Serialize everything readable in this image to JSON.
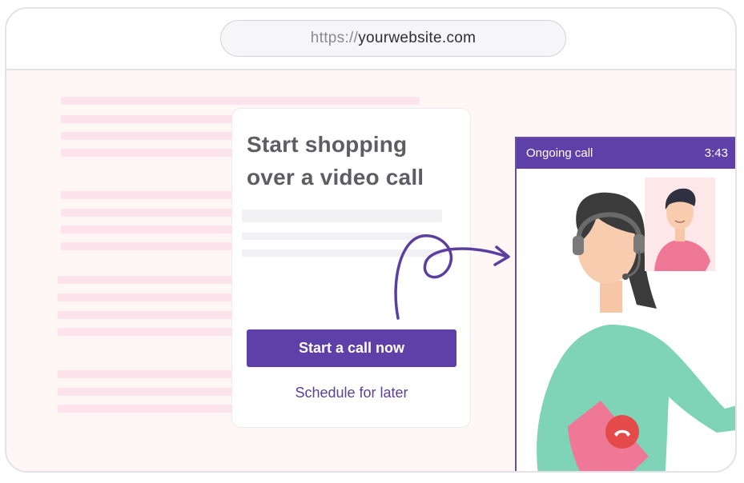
{
  "browser": {
    "url_protocol": "https://",
    "url_host": "yourwebsite.com"
  },
  "card": {
    "title_line1": "Start shopping",
    "title_line2": "over a video call",
    "primary_button": "Start a call now",
    "secondary_link": "Schedule for later"
  },
  "call": {
    "title": "Ongoing call",
    "timer": "3:43",
    "hangup_icon": "phone-hangup-icon"
  },
  "colors": {
    "accent": "#5f3fa8",
    "page_bg": "#fff6f6",
    "hangup": "#e54a4a",
    "agent_shirt": "#7fd4b8",
    "folder": "#ef7896"
  }
}
